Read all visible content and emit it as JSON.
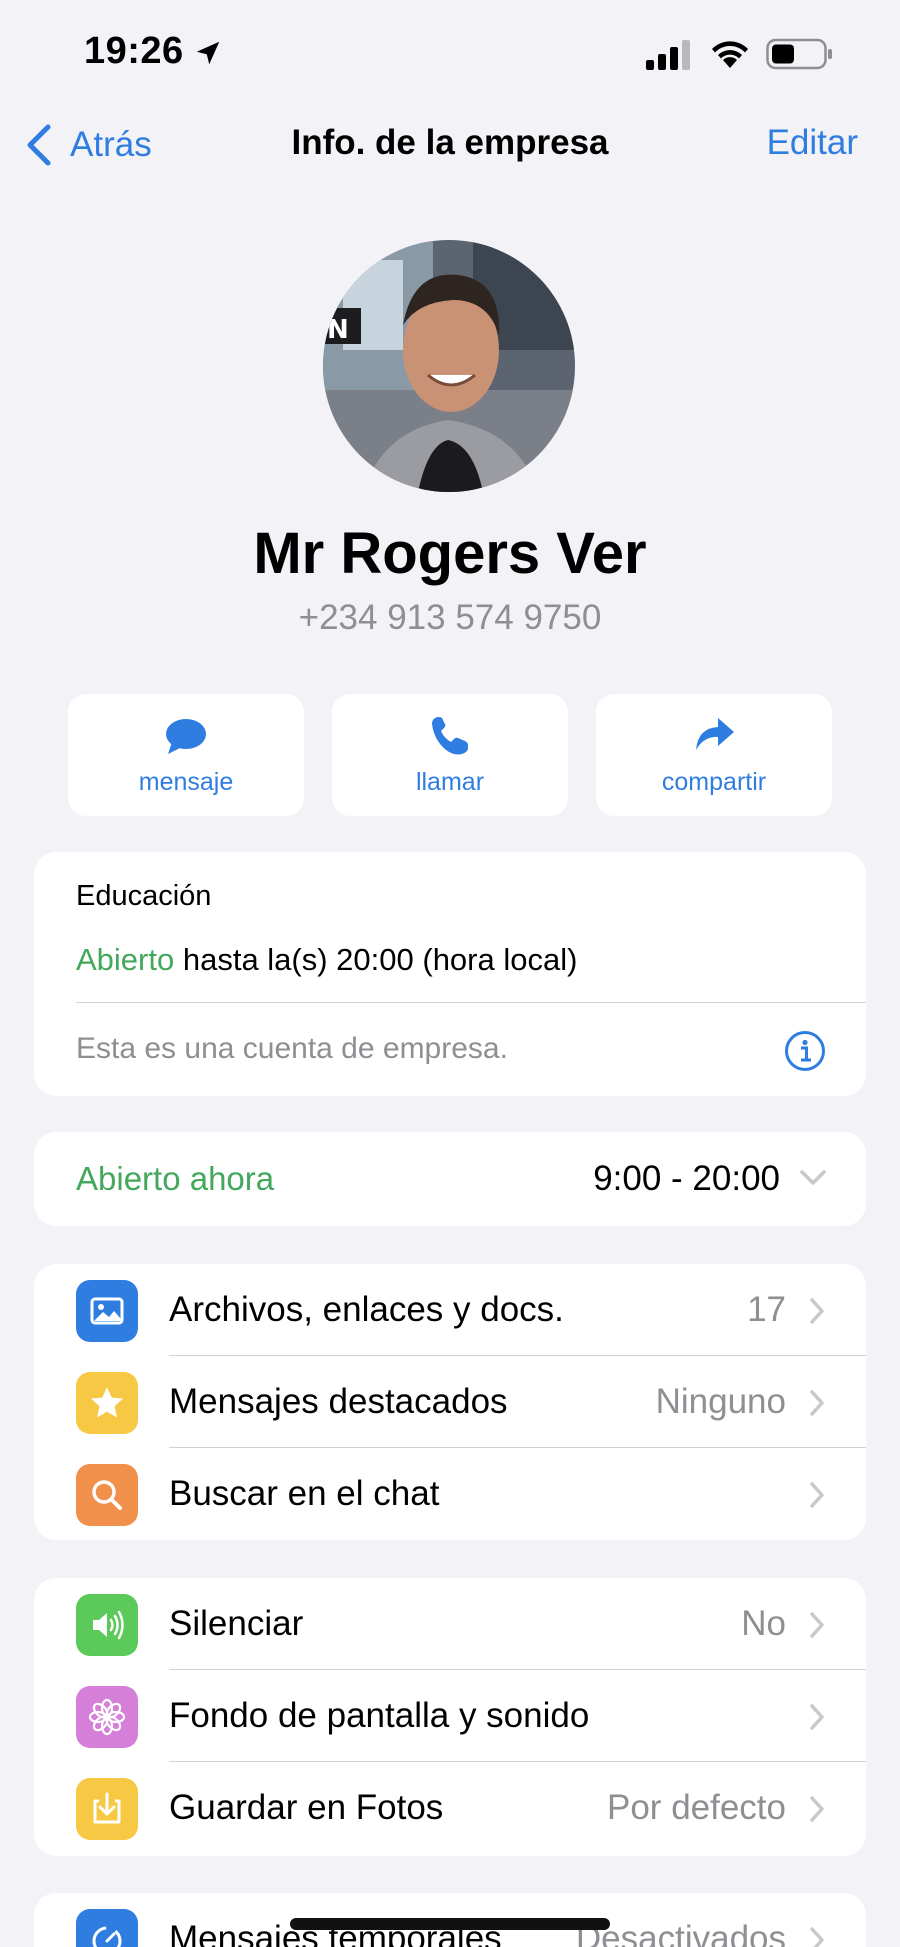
{
  "status_bar": {
    "time": "19:26"
  },
  "nav": {
    "back_label": "Atrás",
    "title": "Info. de la empresa",
    "edit_label": "Editar"
  },
  "contact": {
    "name": "Mr Rogers Ver",
    "phone": "+234 913 574 9750"
  },
  "actions": [
    {
      "label": "mensaje",
      "icon": "message-bubble-icon"
    },
    {
      "label": "llamar",
      "icon": "phone-icon"
    },
    {
      "label": "compartir",
      "icon": "share-arrow-icon"
    }
  ],
  "business": {
    "category": "Educación",
    "open_label": "Abierto",
    "hours_text": " hasta la(s) 20:00 (hora local)",
    "note": "Esta es una cuenta de empresa."
  },
  "hours": {
    "status": "Abierto ahora",
    "range": "9:00 - 20:00"
  },
  "list1": [
    {
      "label": "Archivos, enlaces y docs.",
      "value": "17",
      "icon": "photo-icon",
      "color": "#2f7de1"
    },
    {
      "label": "Mensajes destacados",
      "value": "Ninguno",
      "icon": "star-icon",
      "color": "#f7c844"
    },
    {
      "label": "Buscar en el chat",
      "value": "",
      "icon": "search-icon",
      "color": "#f0904a"
    }
  ],
  "list2": [
    {
      "label": "Silenciar",
      "value": "No",
      "icon": "speaker-icon",
      "color": "#5cc95b"
    },
    {
      "label": "Fondo de pantalla y sonido",
      "value": "",
      "icon": "flower-icon",
      "color": "#d67fd9"
    },
    {
      "label": "Guardar en Fotos",
      "value": "Por defecto",
      "icon": "save-download-icon",
      "color": "#f7c844"
    }
  ],
  "list3": [
    {
      "label": "Mensajes temporales",
      "value": "Desactivados",
      "icon": "timer-icon",
      "color": "#2f7de1"
    }
  ],
  "colors": {
    "accent": "#2f7de1",
    "open_green": "#43a85b",
    "background": "#f2f2f7"
  }
}
